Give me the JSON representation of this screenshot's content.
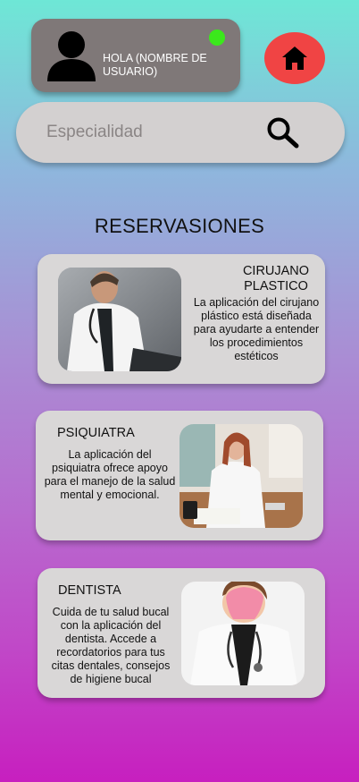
{
  "header": {
    "greeting": "HOLA (NOMBRE DE USUARIO)",
    "status_color": "#3be81c",
    "avatar_icon": "user-silhouette-icon",
    "home_icon": "home-icon",
    "home_button_color": "#f04444"
  },
  "search": {
    "placeholder": "Especialidad",
    "value": "",
    "icon": "search-icon"
  },
  "section": {
    "title": "RESERVASIONES"
  },
  "cards": [
    {
      "title": "CIRUJANO PLASTICO",
      "description": "La aplicación del cirujano plástico está diseñada para ayudarte a entender los procedimientos estéticos",
      "photo": "doctor-photo"
    },
    {
      "title": "PSIQUIATRA",
      "description": "La aplicación del psiquiatra ofrece apoyo para el manejo de la salud mental y emocional.",
      "photo": "psychiatrist-photo"
    },
    {
      "title": "DENTISTA",
      "description": "Cuida de tu salud bucal con la aplicación del dentista. Accede a recordatorios para tus citas dentales, consejos de higiene bucal",
      "photo": "dentist-photo"
    }
  ]
}
